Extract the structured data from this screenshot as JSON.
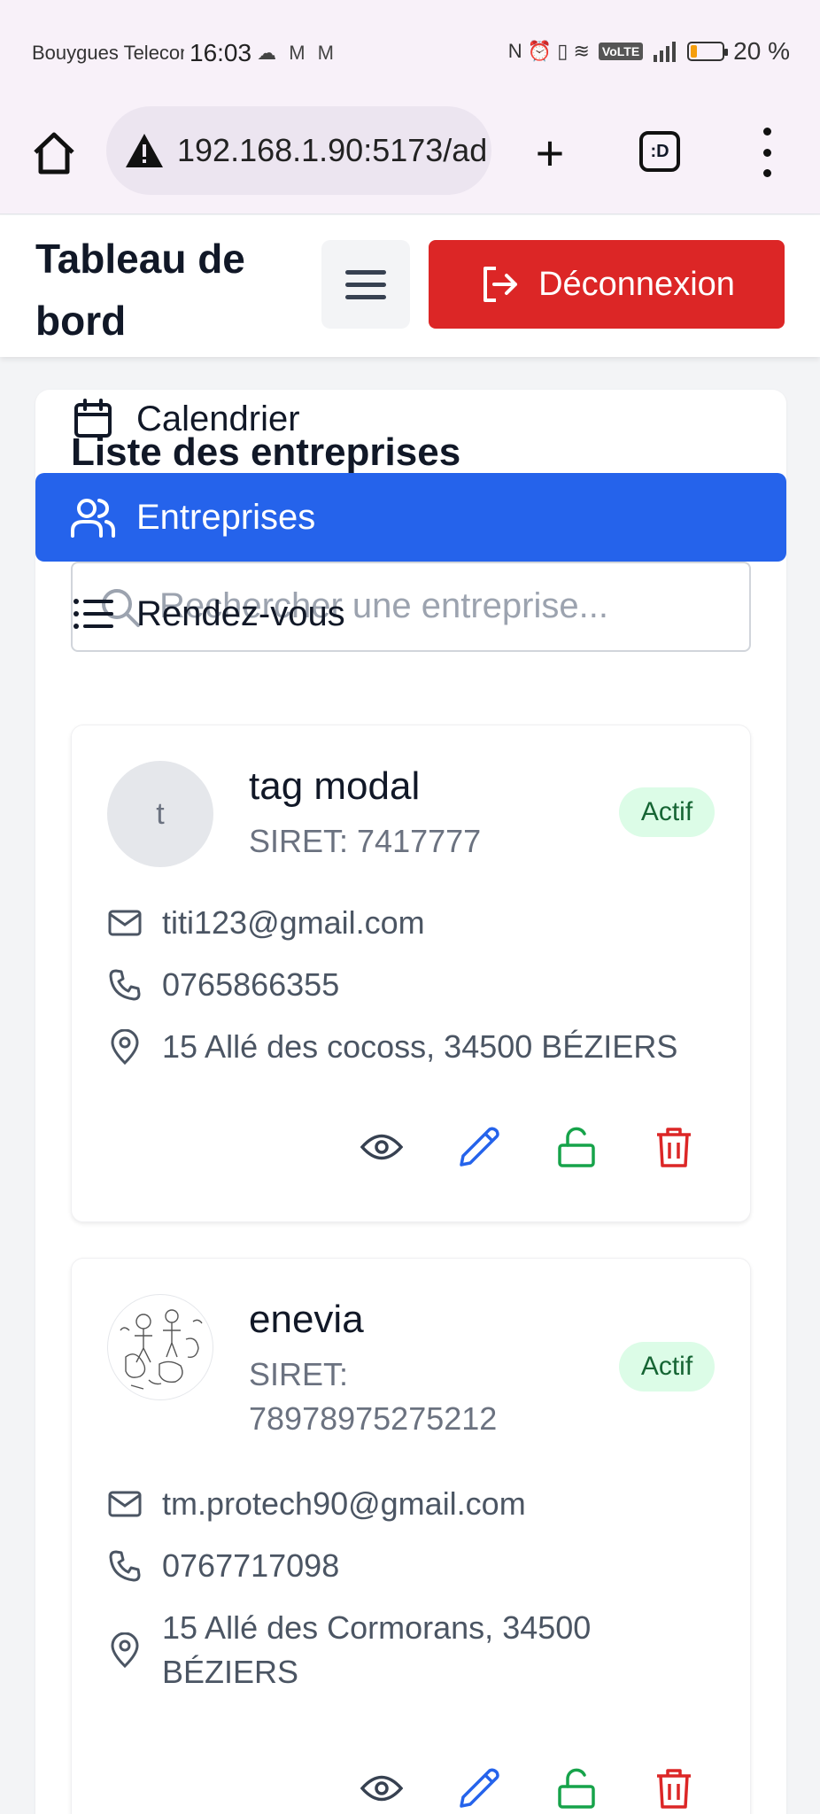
{
  "status_bar": {
    "carrier": "Bouygues Telecom",
    "time": "16:03",
    "notif_icons": "☁ M M",
    "sys_icons": "N ⏰ ▯ ≋",
    "volte": "VoLTE",
    "battery_level": 0.2,
    "battery_pct": "20 %"
  },
  "browser": {
    "url": "192.168.1.90:5173/ad",
    "tabs_label": ":D"
  },
  "header": {
    "title": "Tableau de bord",
    "logout_label": "Déconnexion"
  },
  "nav": {
    "calendar_label": "Calendrier",
    "companies_label": "Entreprises",
    "appointments_label": "Rendez-vous"
  },
  "main": {
    "list_title": "Liste des entreprises",
    "search_placeholder": "Rechercher une entreprise..."
  },
  "companies": [
    {
      "avatar_letter": "t",
      "name": "tag modal",
      "siret": "SIRET: 7417777",
      "status": "Actif",
      "email": "titi123@gmail.com",
      "phone": "0765866355",
      "address": "15 Allé des cocoss, 34500 BÉZIERS"
    },
    {
      "avatar_letter": "",
      "name": "enevia",
      "siret": "SIRET: 78978975275212",
      "status": "Actif",
      "email": "tm.protech90@gmail.com",
      "phone": "0767717098",
      "address": "15 Allé des Cormorans, 34500 BÉZIERS"
    }
  ],
  "colors": {
    "primary": "#2563eb",
    "danger": "#dc2626",
    "success": "#16a34a",
    "badge_bg": "#dcfce7"
  }
}
